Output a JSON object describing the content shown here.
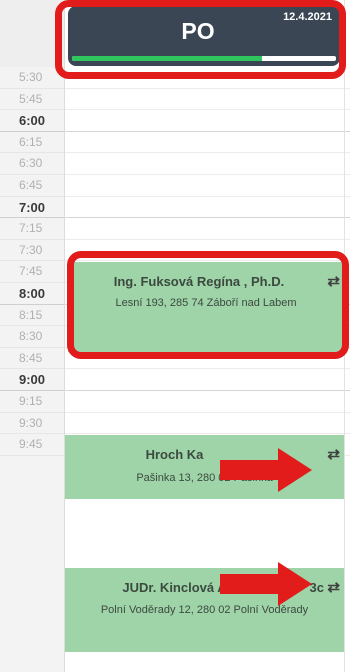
{
  "day_header": {
    "day": "PO",
    "date": "12.4.2021",
    "progress_fraction": 0.72
  },
  "time_slots": [
    {
      "label": "5:30",
      "hour": false
    },
    {
      "label": "5:45",
      "hour": false
    },
    {
      "label": "6:00",
      "hour": true
    },
    {
      "label": "6:15",
      "hour": false
    },
    {
      "label": "6:30",
      "hour": false
    },
    {
      "label": "6:45",
      "hour": false
    },
    {
      "label": "7:00",
      "hour": true
    },
    {
      "label": "7:15",
      "hour": false
    },
    {
      "label": "7:30",
      "hour": false
    },
    {
      "label": "7:45",
      "hour": false
    },
    {
      "label": "8:00",
      "hour": true
    },
    {
      "label": "8:15",
      "hour": false
    },
    {
      "label": "8:30",
      "hour": false
    },
    {
      "label": "8:45",
      "hour": false
    },
    {
      "label": "9:00",
      "hour": true
    },
    {
      "label": "9:15",
      "hour": false
    },
    {
      "label": "9:30",
      "hour": false
    },
    {
      "label": "9:45",
      "hour": false
    }
  ],
  "events": [
    {
      "name": "Ing. Fuksová Regína , Ph.D.",
      "address": "Lesní 193, 285 74 Záboří nad Labem",
      "icon": "swap-icon"
    },
    {
      "name": "Hroch Ka",
      "address": "Pašinka 13, 280 02 Pašinka",
      "icon": "swap-icon"
    },
    {
      "name": "JUDr. Kinclová A",
      "name_tail": "3c",
      "address": "Polní Voděrady 12, 280 02 Polní Voděrady",
      "icon": "swap-icon"
    }
  ],
  "colors": {
    "header_bg": "#3a4654",
    "progress": "#2ec65d",
    "event_bg": "#9fd3a8",
    "annotation": "#e21b1b"
  }
}
